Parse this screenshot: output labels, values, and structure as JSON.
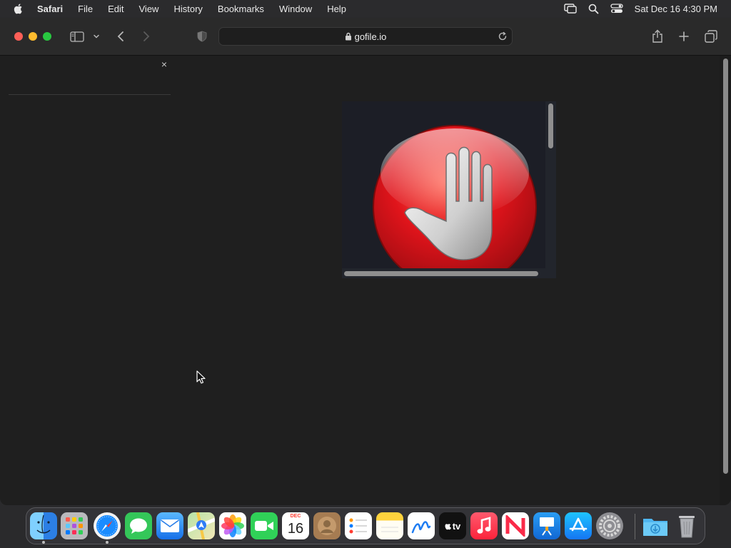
{
  "menubar": {
    "app_name": "Safari",
    "items": [
      "File",
      "Edit",
      "View",
      "History",
      "Bookmarks",
      "Window",
      "Help"
    ],
    "clock": "Sat Dec 16  4:30 PM"
  },
  "browser": {
    "url": "gofile.io"
  },
  "sidebar": {
    "close_glyph": "×"
  },
  "dock": {
    "apps": [
      "Finder",
      "Launchpad",
      "Safari",
      "Messages",
      "Mail",
      "Maps",
      "Photos",
      "FaceTime",
      "Calendar",
      "Contacts",
      "Reminders",
      "Notes",
      "Freeform",
      "TV",
      "Music",
      "News",
      "Keynote",
      "App Store",
      "System Settings",
      "Downloads",
      "Trash"
    ],
    "calendar_month": "DEC",
    "calendar_day": "16",
    "tv_label": "tv"
  },
  "colors": {
    "close": "#fe5f57",
    "minimize": "#febc2e",
    "maximize": "#28c840",
    "stop_red": "#d7191e"
  }
}
